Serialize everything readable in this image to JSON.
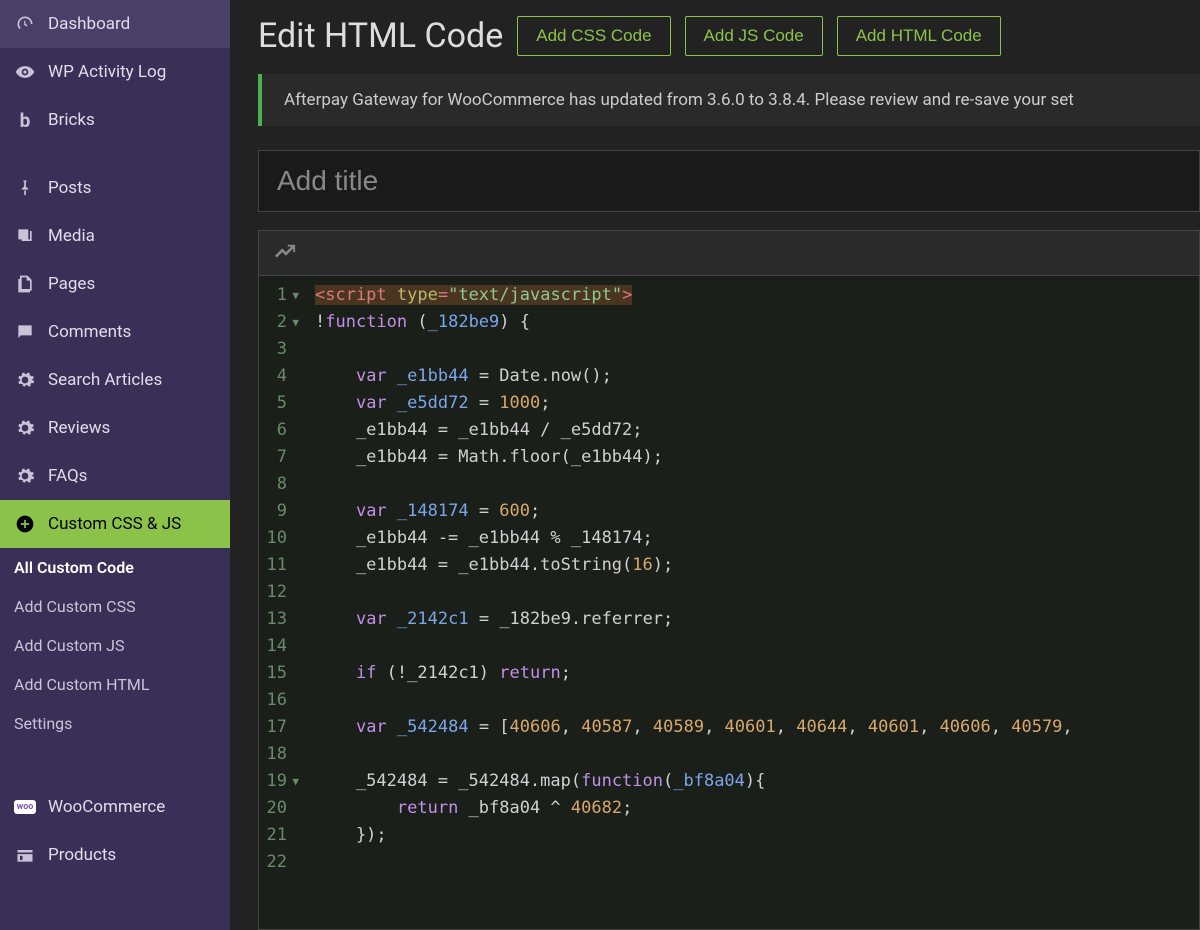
{
  "sidebar": {
    "items": [
      {
        "label": "Dashboard",
        "icon": "gauge"
      },
      {
        "label": "WP Activity Log",
        "icon": "eye"
      },
      {
        "label": "Bricks",
        "icon": "b"
      },
      {
        "label": "Posts",
        "icon": "pin"
      },
      {
        "label": "Media",
        "icon": "media"
      },
      {
        "label": "Pages",
        "icon": "pages"
      },
      {
        "label": "Comments",
        "icon": "comment"
      },
      {
        "label": "Search Articles",
        "icon": "gear"
      },
      {
        "label": "Reviews",
        "icon": "gear"
      },
      {
        "label": "FAQs",
        "icon": "gear"
      },
      {
        "label": "Custom CSS & JS",
        "icon": "plus-circle",
        "active": true
      },
      {
        "label": "WooCommerce",
        "icon": "woo"
      },
      {
        "label": "Products",
        "icon": "products"
      }
    ],
    "subitems": [
      {
        "label": "All Custom Code",
        "active": true
      },
      {
        "label": "Add Custom CSS"
      },
      {
        "label": "Add Custom JS"
      },
      {
        "label": "Add Custom HTML"
      },
      {
        "label": "Settings"
      }
    ]
  },
  "header": {
    "title": "Edit HTML Code",
    "buttons": [
      "Add CSS Code",
      "Add JS Code",
      "Add HTML Code"
    ]
  },
  "notice": "Afterpay Gateway for WooCommerce has updated from 3.6.0 to 3.8.4. Please review and re-save your set",
  "title_placeholder": "Add title",
  "code": {
    "lines": [
      {
        "n": 1,
        "fold": true,
        "tokens": [
          [
            "hl-script-open",
            ""
          ],
          [
            "tok-tag",
            "<script "
          ],
          [
            "tok-attr",
            "type"
          ],
          [
            "tok-tag",
            "="
          ],
          [
            "tok-str",
            "\"text/javascript\""
          ],
          [
            "tok-tag",
            ">"
          ],
          [
            "hl-script-close",
            ""
          ]
        ]
      },
      {
        "n": 2,
        "fold": true,
        "tokens": [
          [
            "tok-op",
            "!"
          ],
          [
            "tok-kw",
            "function"
          ],
          [
            "",
            " ("
          ],
          [
            "tok-var",
            "_182be9"
          ],
          [
            "",
            ") {"
          ]
        ]
      },
      {
        "n": 3,
        "tokens": [
          [
            "",
            ""
          ]
        ]
      },
      {
        "n": 4,
        "tokens": [
          [
            "",
            "    "
          ],
          [
            "tok-kw",
            "var"
          ],
          [
            "",
            " "
          ],
          [
            "tok-var",
            "_e1bb44"
          ],
          [
            "",
            " = Date.now();"
          ]
        ]
      },
      {
        "n": 5,
        "tokens": [
          [
            "",
            "    "
          ],
          [
            "tok-kw",
            "var"
          ],
          [
            "",
            " "
          ],
          [
            "tok-var",
            "_e5dd72"
          ],
          [
            "",
            " = "
          ],
          [
            "tok-num",
            "1000"
          ],
          [
            "",
            ";"
          ]
        ]
      },
      {
        "n": 6,
        "tokens": [
          [
            "",
            "    _e1bb44 = _e1bb44 / _e5dd72;"
          ]
        ]
      },
      {
        "n": 7,
        "tokens": [
          [
            "",
            "    _e1bb44 = Math.floor(_e1bb44);"
          ]
        ]
      },
      {
        "n": 8,
        "tokens": [
          [
            "",
            ""
          ]
        ]
      },
      {
        "n": 9,
        "tokens": [
          [
            "",
            "    "
          ],
          [
            "tok-kw",
            "var"
          ],
          [
            "",
            " "
          ],
          [
            "tok-var",
            "_148174"
          ],
          [
            "",
            " = "
          ],
          [
            "tok-num",
            "600"
          ],
          [
            "",
            ";"
          ]
        ]
      },
      {
        "n": 10,
        "tokens": [
          [
            "",
            "    _e1bb44 -= _e1bb44 % _148174;"
          ]
        ]
      },
      {
        "n": 11,
        "tokens": [
          [
            "",
            "    _e1bb44 = _e1bb44.toString("
          ],
          [
            "tok-num",
            "16"
          ],
          [
            "",
            ");"
          ]
        ]
      },
      {
        "n": 12,
        "tokens": [
          [
            "",
            ""
          ]
        ]
      },
      {
        "n": 13,
        "tokens": [
          [
            "",
            "    "
          ],
          [
            "tok-kw",
            "var"
          ],
          [
            "",
            " "
          ],
          [
            "tok-var",
            "_2142c1"
          ],
          [
            "",
            " = _182be9.referrer;"
          ]
        ]
      },
      {
        "n": 14,
        "tokens": [
          [
            "",
            ""
          ]
        ]
      },
      {
        "n": 15,
        "tokens": [
          [
            "",
            "    "
          ],
          [
            "tok-kw",
            "if"
          ],
          [
            "",
            " (!_2142c1) "
          ],
          [
            "tok-kw",
            "return"
          ],
          [
            "",
            ";"
          ]
        ]
      },
      {
        "n": 16,
        "tokens": [
          [
            "",
            ""
          ]
        ]
      },
      {
        "n": 17,
        "tokens": [
          [
            "",
            "    "
          ],
          [
            "tok-kw",
            "var"
          ],
          [
            "",
            " "
          ],
          [
            "tok-var",
            "_542484"
          ],
          [
            "",
            " = ["
          ],
          [
            "tok-num",
            "40606"
          ],
          [
            "",
            ", "
          ],
          [
            "tok-num",
            "40587"
          ],
          [
            "",
            ", "
          ],
          [
            "tok-num",
            "40589"
          ],
          [
            "",
            ", "
          ],
          [
            "tok-num",
            "40601"
          ],
          [
            "",
            ", "
          ],
          [
            "tok-num",
            "40644"
          ],
          [
            "",
            ", "
          ],
          [
            "tok-num",
            "40601"
          ],
          [
            "",
            ", "
          ],
          [
            "tok-num",
            "40606"
          ],
          [
            "",
            ", "
          ],
          [
            "tok-num",
            "40579"
          ],
          [
            "",
            ", "
          ]
        ]
      },
      {
        "n": 18,
        "tokens": [
          [
            "",
            ""
          ]
        ]
      },
      {
        "n": 19,
        "fold": true,
        "tokens": [
          [
            "",
            "    _542484 = _542484.map("
          ],
          [
            "tok-kw",
            "function"
          ],
          [
            "",
            "("
          ],
          [
            "tok-var",
            "_bf8a04"
          ],
          [
            "",
            "){"
          ]
        ]
      },
      {
        "n": 20,
        "tokens": [
          [
            "",
            "        "
          ],
          [
            "tok-kw",
            "return"
          ],
          [
            "",
            " _bf8a04 ^ "
          ],
          [
            "tok-num",
            "40682"
          ],
          [
            "",
            ";"
          ]
        ]
      },
      {
        "n": 21,
        "tokens": [
          [
            "",
            "    });"
          ]
        ]
      },
      {
        "n": 22,
        "tokens": [
          [
            "",
            ""
          ]
        ]
      }
    ]
  }
}
